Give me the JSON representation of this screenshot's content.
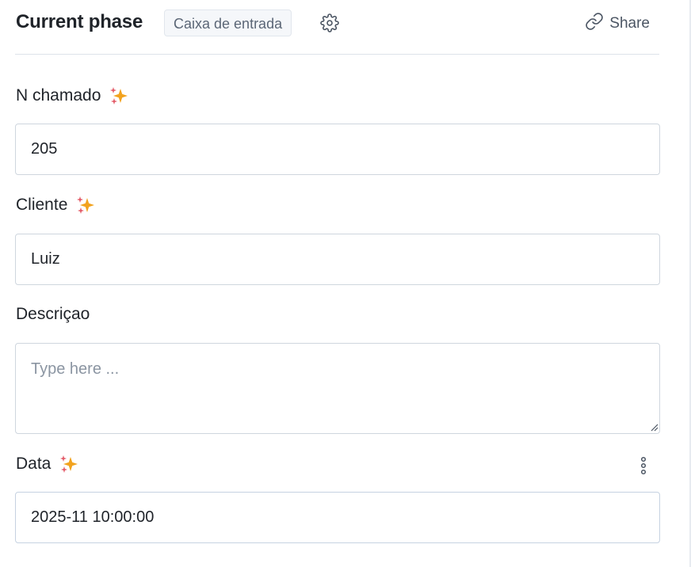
{
  "header": {
    "title": "Current phase",
    "phase_badge": "Caixa de entrada",
    "settings_icon": "gear-icon",
    "share_label": "Share",
    "share_icon": "link-icon"
  },
  "fields": [
    {
      "label": "N chamado",
      "ai_icon": "sparkles-icon",
      "value": "205"
    },
    {
      "label": "Cliente",
      "ai_icon": "sparkles-icon",
      "value": "Luiz"
    },
    {
      "label": "Descriçao",
      "placeholder": "Type here ...",
      "value": ""
    },
    {
      "label": "Data",
      "ai_icon": "sparkles-icon",
      "menu_icon": "more-vertical-icon",
      "value": "2025-11 10:00:00"
    }
  ],
  "colors": {
    "sparkle_primary": "#f2a31f",
    "sparkle_secondary": "#e35d6a",
    "border": "#cfd6de",
    "badge_bg": "#f5f7fa"
  }
}
